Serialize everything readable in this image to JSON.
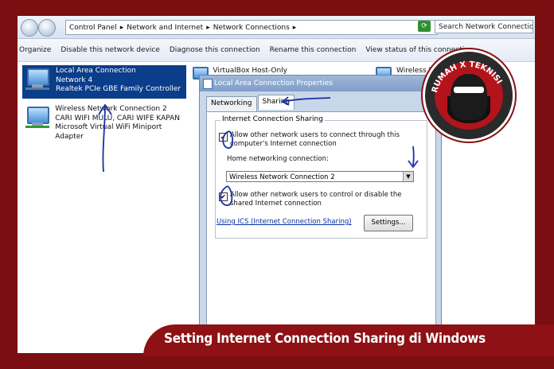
{
  "addressbar": {
    "breadcrumbs": [
      "Control Panel",
      "Network and Internet",
      "Network Connections"
    ],
    "search_placeholder": "Search Network Connections"
  },
  "toolbar": {
    "items": [
      "Organize",
      "Disable this network device",
      "Diagnose this connection",
      "Rename this connection",
      "View status of this connection"
    ]
  },
  "connections": [
    {
      "name": "Local Area Connection",
      "network": "Network  4",
      "adapter": "Realtek PCIe GBE Family Controller",
      "selected": true
    },
    {
      "name": "Wireless Network Connection 2",
      "network": "CARI WIFI MULU, CARI WIFE KAPAN",
      "adapter": "Microsoft Virtual WiFi Miniport Adapter",
      "selected": false
    },
    {
      "name": "VirtualBox Host-Only Network",
      "network": "",
      "adapter": "",
      "selected": false
    },
    {
      "name": "Wireless N",
      "network": "",
      "adapter": "",
      "selected": false
    }
  ],
  "dialog": {
    "title": "Local Area Connection Properties",
    "tabs": [
      "Networking",
      "Sharing"
    ],
    "active_tab": "Sharing",
    "group_label": "Internet Connection Sharing",
    "allow_connect_label": "Allow other network users to connect through this computer's Internet connection",
    "allow_connect_checked": true,
    "home_network_label": "Home networking connection:",
    "home_network_value": "Wireless Network Connection 2",
    "allow_control_label": "Allow other network users to control or disable the shared Internet connection",
    "allow_control_checked": true,
    "ics_link": "Using ICS (Internet Connection Sharing)",
    "settings_button": "Settings..."
  },
  "logo": {
    "text": "RUMAH X TEKNISI"
  },
  "banner": {
    "caption": "Setting Internet Connection Sharing di Windows"
  },
  "colors": {
    "frame": "#7a0e10",
    "banner": "#8e1115",
    "selection": "#0a3d8a",
    "annotation": "#1a2ea8"
  }
}
